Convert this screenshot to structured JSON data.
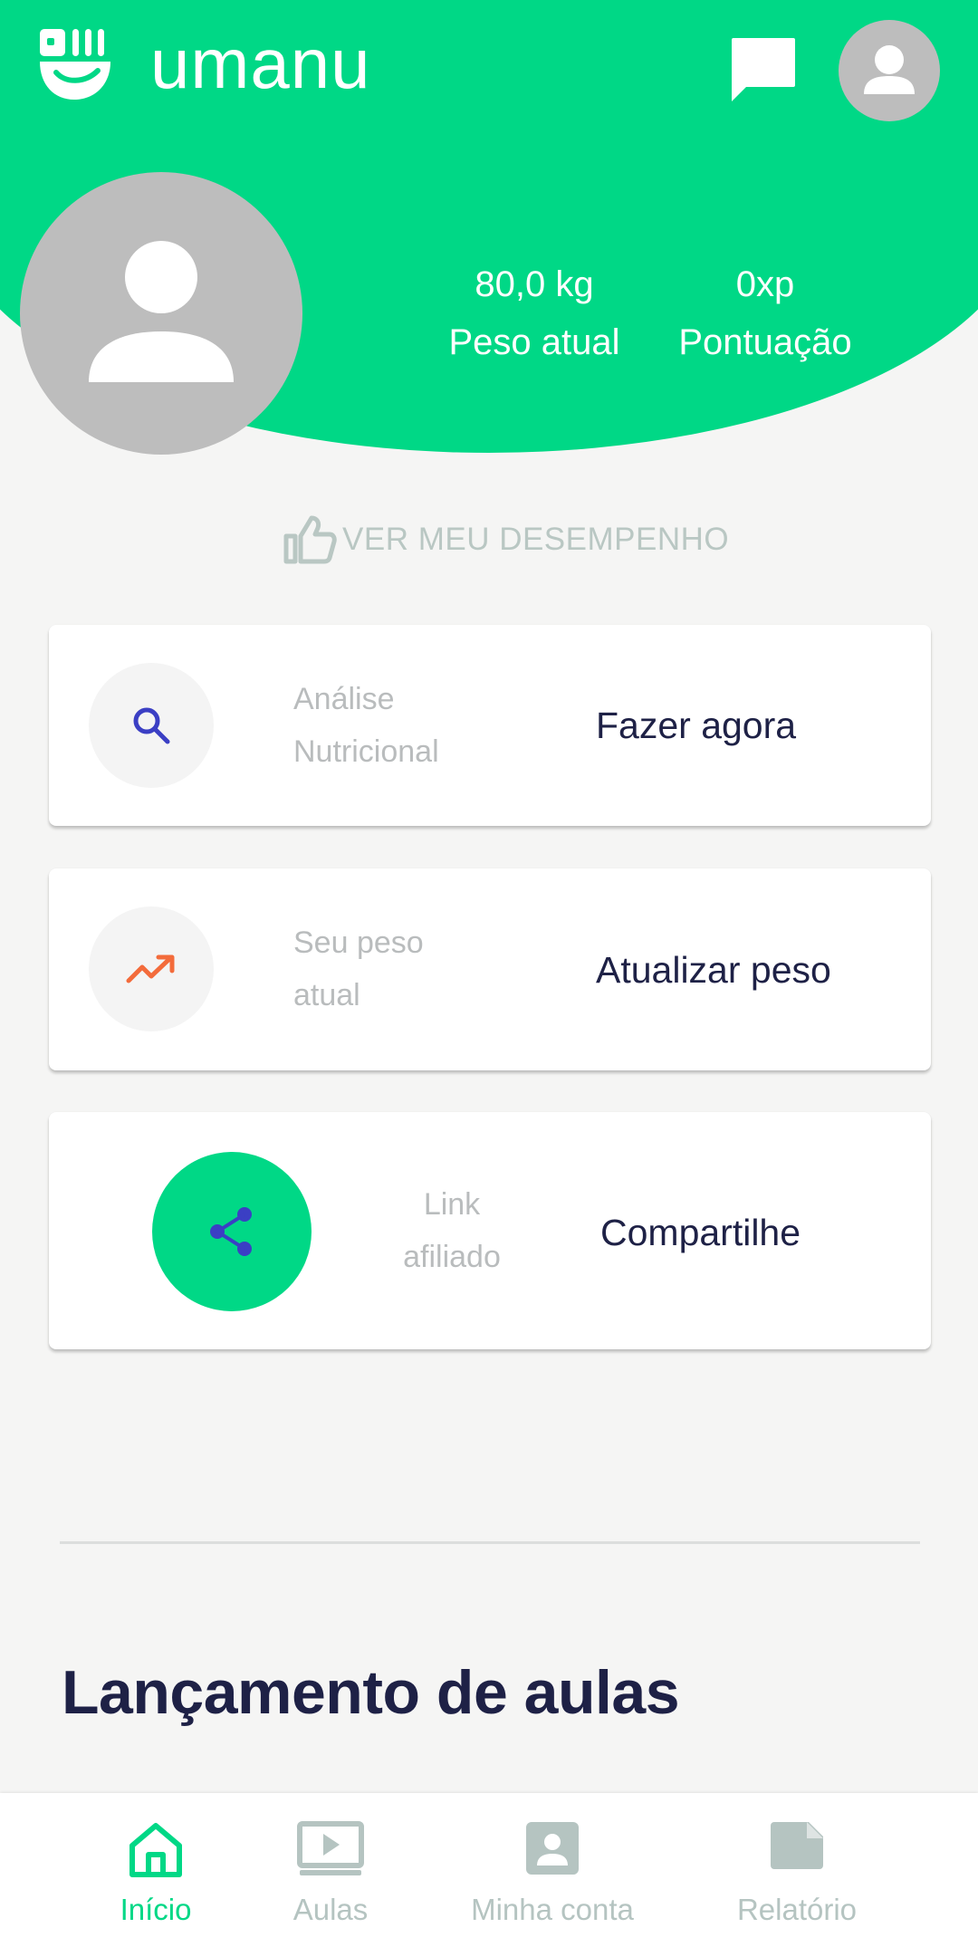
{
  "app": {
    "name": "umanu"
  },
  "header": {
    "stats": [
      {
        "value": "80,0 kg",
        "label": "Peso atual"
      },
      {
        "value": "0xp",
        "label": "Pontuação"
      }
    ]
  },
  "performance_link": {
    "label": "VER MEU DESEMPENHO",
    "icon": "thumbs-up-icon"
  },
  "cards": [
    {
      "label": "Análise Nutricional",
      "action": "Fazer agora",
      "icon": "search-icon",
      "icon_color": "#3b3fc4"
    },
    {
      "label": "Seu peso atual",
      "action": "Atualizar peso",
      "icon": "trending-up-icon",
      "icon_color": "#f36b3b"
    },
    {
      "label": "Link afiliado",
      "action": "Compartilhe",
      "icon": "share-icon",
      "icon_color": "#3b3fc4"
    }
  ],
  "section": {
    "title": "Lançamento de aulas"
  },
  "nav": {
    "items": [
      {
        "label": "Início",
        "icon": "home-icon",
        "active": true
      },
      {
        "label": "Aulas",
        "icon": "video-icon",
        "active": false
      },
      {
        "label": "Minha conta",
        "icon": "account-icon",
        "active": false
      },
      {
        "label": "Relatório",
        "icon": "report-icon",
        "active": false
      }
    ]
  },
  "colors": {
    "brand": "#00d886",
    "text_dark": "#1e2146",
    "muted": "#b9bcbd"
  }
}
